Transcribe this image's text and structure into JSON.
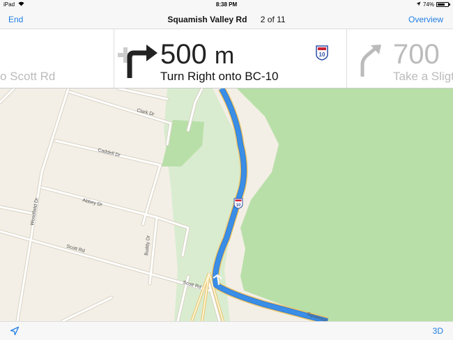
{
  "status_bar": {
    "device": "iPad",
    "time": "8:38 PM",
    "battery": "74%",
    "battery_level": 0.74
  },
  "nav_bar": {
    "end_label": "End",
    "road_name": "Squamish Valley Rd",
    "step_counter": "2 of 11",
    "overview_label": "Overview"
  },
  "directions": {
    "previous": {
      "instruction": "o Scott Rd",
      "arrow_icon": "turn-icon"
    },
    "current": {
      "distance_value": "500",
      "distance_unit": "m",
      "instruction": "Turn Right onto BC-10",
      "arrow_icon": "turn-right-arrow-icon",
      "shield_number": "10"
    },
    "next": {
      "distance_value": "700",
      "instruction": "Take a Sligt",
      "arrow_icon": "slight-right-arrow-icon"
    }
  },
  "map": {
    "street_labels": [
      "Clark Dr",
      "Caddell Dr",
      "Abbey Dr",
      "Woodfield Dr",
      "Scott Rd",
      "Scott Rd",
      "Buddy Dr",
      "Squamish"
    ],
    "route_shield_number": "10",
    "colors": {
      "land": "#f3efe6",
      "park": "#b8dfa8",
      "park_light": "#d9ecd0",
      "route": "#3a8ee6",
      "road": "#ffffff",
      "road_outline": "#d8d2c4",
      "highway_outline": "#e9c46a"
    }
  },
  "bottom_bar": {
    "location_icon": "location-arrow-icon",
    "three_d_label": "3D"
  },
  "colors": {
    "accent": "#1f7ee4",
    "bar_background": "#f7f7f7"
  }
}
